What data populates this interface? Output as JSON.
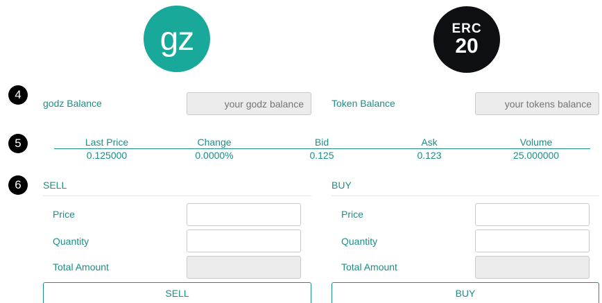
{
  "logos": {
    "left_text": "gz",
    "right_line1": "ERC",
    "right_line2": "20"
  },
  "steps": [
    "4",
    "5",
    "6"
  ],
  "balances": {
    "godz_label": "godz Balance",
    "godz_placeholder": "your godz balance",
    "token_label": "Token Balance",
    "token_placeholder": "your tokens balance"
  },
  "stats": {
    "headers": [
      "Last Price",
      "Change",
      "Bid",
      "Ask",
      "Volume"
    ],
    "values": [
      "0.125000",
      "0.0000%",
      "0.125",
      "0.123",
      "25.000000"
    ]
  },
  "sell": {
    "title": "SELL",
    "price_label": "Price",
    "quantity_label": "Quantity",
    "total_label": "Total Amount",
    "button_label": "SELL"
  },
  "buy": {
    "title": "BUY",
    "price_label": "Price",
    "quantity_label": "Quantity",
    "total_label": "Total Amount",
    "button_label": "BUY"
  },
  "colors": {
    "accent": "#1a8f86",
    "gz_logo": "#18a99a",
    "erc_logo": "#0d0f12"
  }
}
